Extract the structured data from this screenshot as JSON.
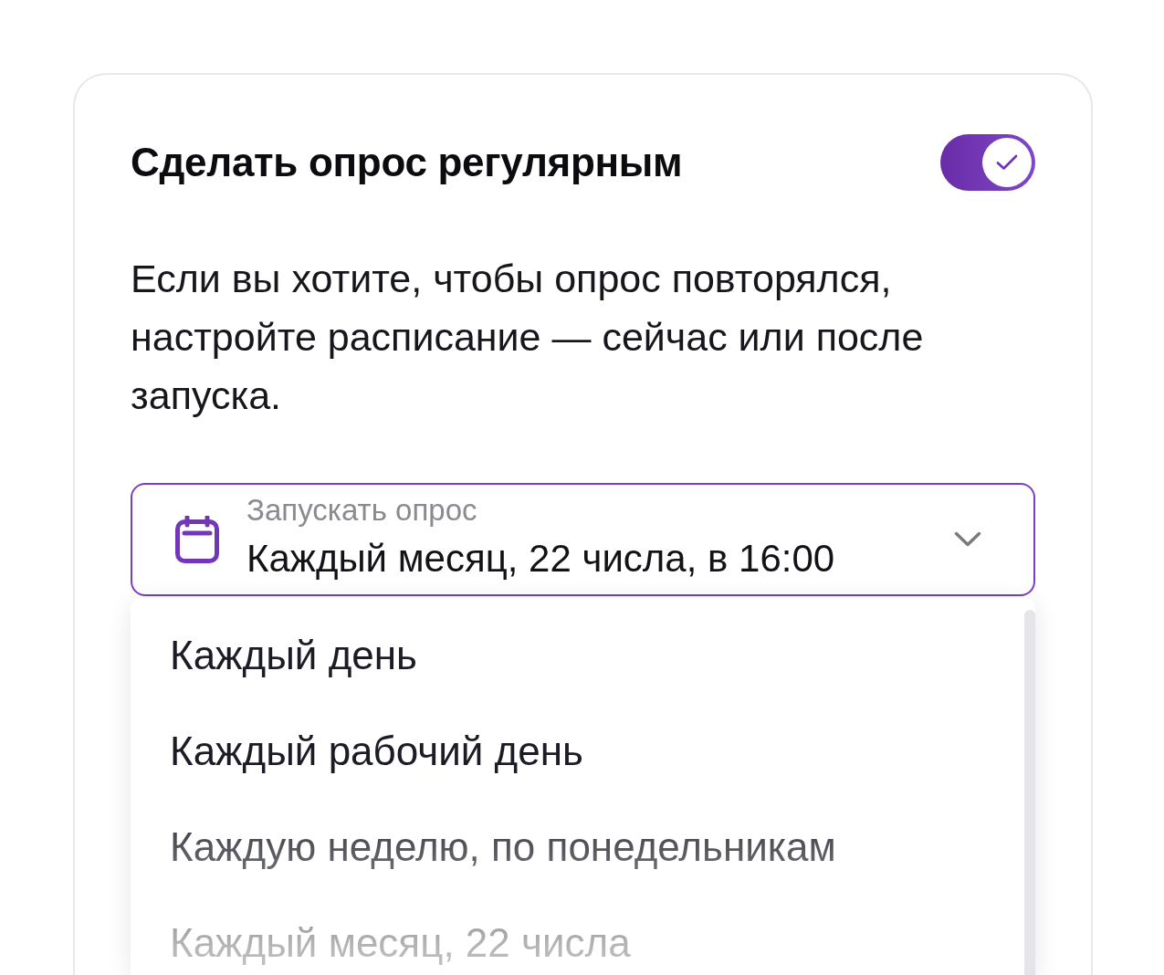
{
  "card": {
    "title": "Сделать опрос регулярным",
    "toggle": {
      "on": true
    },
    "description": "Если вы хотите, чтобы опрос повторялся, настройте расписание — сейчас или после запуска.",
    "schedule": {
      "label": "Запускать опрос",
      "value": "Каждый месяц, 22 числа, в 16:00",
      "expanded": true,
      "options": [
        {
          "label": "Каждый день",
          "selected": false
        },
        {
          "label": "Каждый рабочий день",
          "selected": false
        },
        {
          "label": "Каждую неделю, по понедельникам",
          "selected": false
        },
        {
          "label": "Каждый месяц, 22 числа",
          "selected": false
        }
      ]
    }
  }
}
